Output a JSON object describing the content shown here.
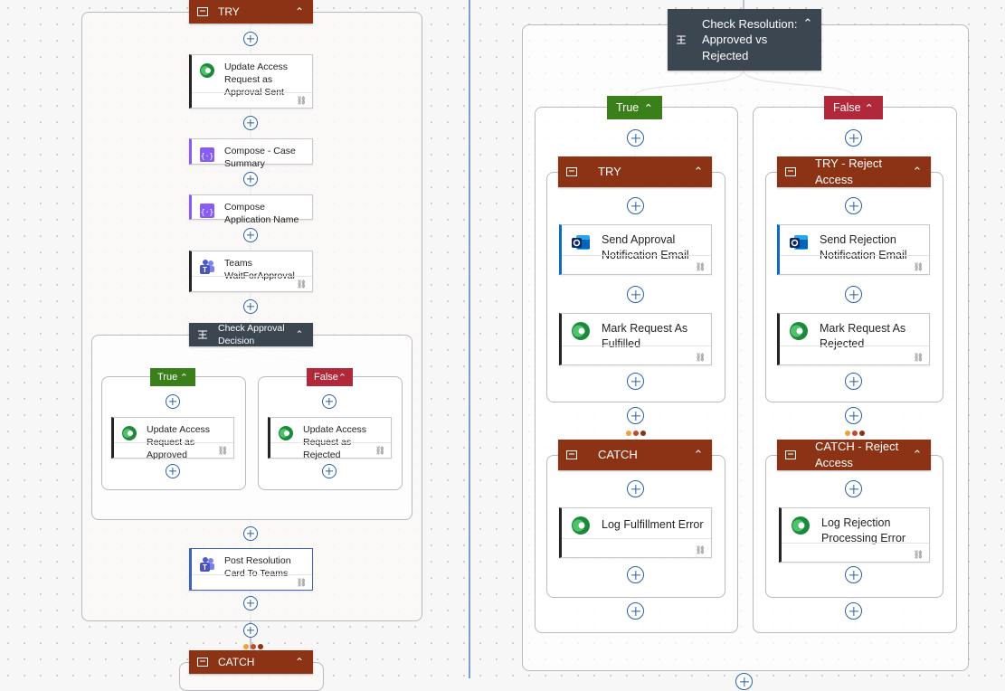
{
  "colors": {
    "try_header": "#8c3315",
    "condition_header": "#3c4651",
    "true_tag": "#3b7f1b",
    "false_tag": "#b0283a",
    "add_button": "#2a5fa8",
    "divider": "#7d9ccd"
  },
  "left": {
    "try": {
      "label": "TRY"
    },
    "steps": [
      {
        "label": "Update Access Request as Approval Sent",
        "icon": "dataverse-icon"
      },
      {
        "label": "Compose - Case Summary",
        "icon": "compose-icon"
      },
      {
        "label": "Compose Application Name",
        "icon": "compose-icon"
      },
      {
        "label": "Teams WaitForApproval",
        "icon": "teams-icon"
      }
    ],
    "condition": {
      "label": "Check Approval Decision"
    },
    "true_branch": {
      "tag": "True",
      "action": "Update Access Request as Approved"
    },
    "false_branch": {
      "tag": "False",
      "action": "Update Access Request as Rejected"
    },
    "post_card": {
      "label": "Post Resolution Card To Teams"
    },
    "catch": {
      "label": "CATCH"
    }
  },
  "right": {
    "condition": {
      "label": "Check Resolution: Approved vs Rejected"
    },
    "true_branch": {
      "tag": "True",
      "try": "TRY",
      "email": "Send Approval Notification Email",
      "mark": "Mark Request As Fulfilled",
      "catch": "CATCH",
      "log": "Log Fulfillment Error"
    },
    "false_branch": {
      "tag": "False",
      "try": "TRY - Reject Access",
      "email": "Send Rejection Notification Email",
      "mark": "Mark Request As Rejected",
      "catch": "CATCH - Reject Access",
      "log": "Log Rejection Processing Error"
    }
  }
}
